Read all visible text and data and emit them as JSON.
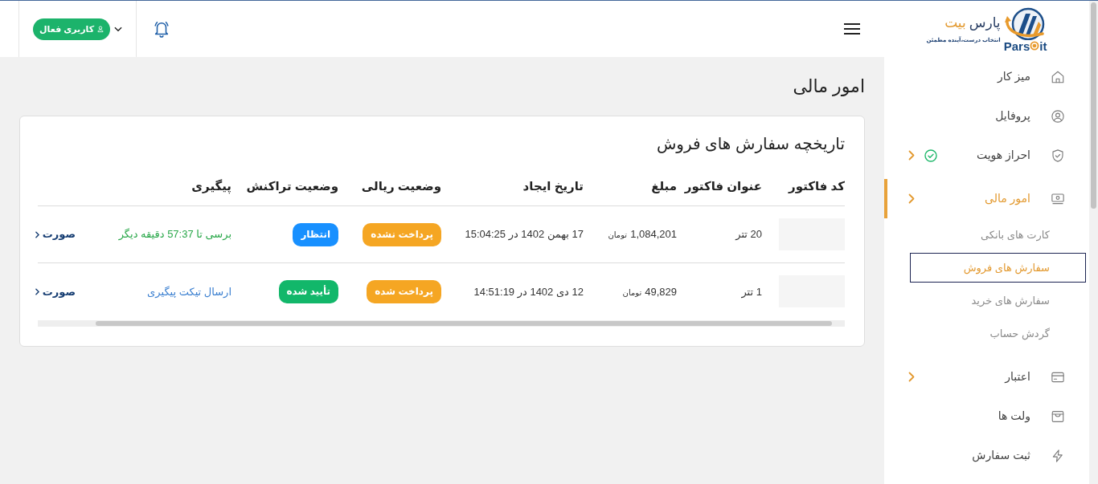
{
  "logo": {
    "name_parts": [
      "پارس",
      "بیت"
    ],
    "tagline": "انتخاب درست،آینده مطمئن",
    "wordmark": [
      "it",
      "Pars"
    ]
  },
  "header": {
    "user_button": {
      "label": "کاربری فعال"
    }
  },
  "sidebar": {
    "items": [
      {
        "label": "میز کار",
        "selected": false,
        "verified": false,
        "has_submenu": false
      },
      {
        "label": "پروفایل",
        "selected": false,
        "verified": false,
        "has_submenu": false
      },
      {
        "label": "احراز هویت",
        "selected": false,
        "verified": true,
        "has_submenu": true
      },
      {
        "label": "امور مالی",
        "selected": true,
        "verified": false,
        "has_submenu": true,
        "children": [
          {
            "label": "کارت های بانکی",
            "selected": false
          },
          {
            "label": "سفارش های فروش",
            "selected": true
          },
          {
            "label": "سفارش های خرید",
            "selected": false
          },
          {
            "label": "گردش حساب",
            "selected": false
          }
        ]
      },
      {
        "label": "اعتبار",
        "selected": false,
        "verified": false,
        "has_submenu": true
      },
      {
        "label": "ولت ها",
        "selected": false,
        "verified": false,
        "has_submenu": false
      },
      {
        "label": "ثبت سفارش",
        "selected": false,
        "verified": false,
        "has_submenu": false
      }
    ]
  },
  "page": {
    "title": "امور مالی"
  },
  "card": {
    "title": "تاریخچه سفارش های فروش",
    "table": {
      "columns": [
        "کد فاکتور",
        "عنوان فاکتور",
        "مبلغ",
        "تاریخ ایجاد",
        "وضعیت ریالی",
        "وضعیت تراکنش",
        "پیگیری"
      ],
      "rows": [
        {
          "title": "20 تتر",
          "amount": "1,084,201",
          "currency": "تومان",
          "created": "17 بهمن 1402 در 15:04:25",
          "payment_status": {
            "label": "پرداخت نشده",
            "color": "#f5a623"
          },
          "transaction_status": {
            "label": "انتظار",
            "color": "#1890ff"
          },
          "follow_up": {
            "kind": "timer",
            "text": "برسی تا 57:37 دقیقه دیگر"
          },
          "action": "صورت"
        },
        {
          "title": "1 تتر",
          "amount": "49,829",
          "currency": "تومان",
          "created": "12 دی 1402 در 14:51:19",
          "payment_status": {
            "label": "پرداخت شده",
            "color": "#f5a623"
          },
          "transaction_status": {
            "label": "تأیید شده",
            "color": "#12b76a"
          },
          "follow_up": {
            "kind": "link",
            "text": "ارسال تیکت پیگیری"
          },
          "action": "صورت"
        }
      ]
    }
  }
}
